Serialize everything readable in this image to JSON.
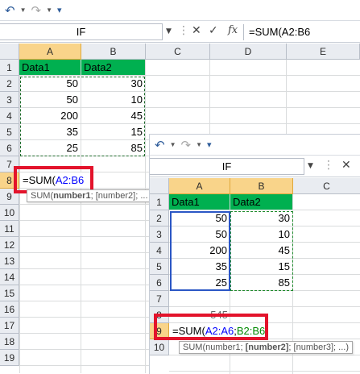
{
  "colors": {
    "accent_red": "#e3132b",
    "header_green": "#00b050",
    "ref_blue": "#0000ff",
    "ref_green": "#008a00"
  },
  "left": {
    "name_box": "IF",
    "formula": "=SUM(A2:B6",
    "columns": [
      "A",
      "B",
      "C",
      "D",
      "E"
    ],
    "rows": [
      "1",
      "2",
      "3",
      "4",
      "5",
      "6",
      "7",
      "8",
      "9",
      "10",
      "11",
      "12",
      "13",
      "14",
      "15",
      "16",
      "17",
      "18",
      "19"
    ],
    "headers": [
      "Data1",
      "Data2"
    ],
    "data": [
      [
        "50",
        "30"
      ],
      [
        "50",
        "10"
      ],
      [
        "200",
        "45"
      ],
      [
        "35",
        "15"
      ],
      [
        "25",
        "85"
      ]
    ],
    "edit": {
      "prefix": "=SUM(",
      "ref": "A2:B6"
    },
    "tooltip": {
      "fn": "SUM(",
      "bold": "number1",
      "rest": "; [number2]; ..."
    }
  },
  "right": {
    "name_box": "IF",
    "columns": [
      "A",
      "B",
      "C"
    ],
    "rows": [
      "1",
      "2",
      "3",
      "4",
      "5",
      "6",
      "7",
      "8",
      "9",
      "10"
    ],
    "headers": [
      "Data1",
      "Data2"
    ],
    "data": [
      [
        "50",
        "30"
      ],
      [
        "50",
        "10"
      ],
      [
        "200",
        "45"
      ],
      [
        "35",
        "15"
      ],
      [
        "25",
        "85"
      ]
    ],
    "partial": "545",
    "edit": {
      "prefix": "=SUM(",
      "ref1": "A2:A6",
      "sep": ";",
      "ref2": "B2:B6"
    },
    "tooltip": {
      "fn": "SUM(number1; ",
      "bold": "[number2]",
      "rest": "; [number3]; ...)"
    }
  }
}
